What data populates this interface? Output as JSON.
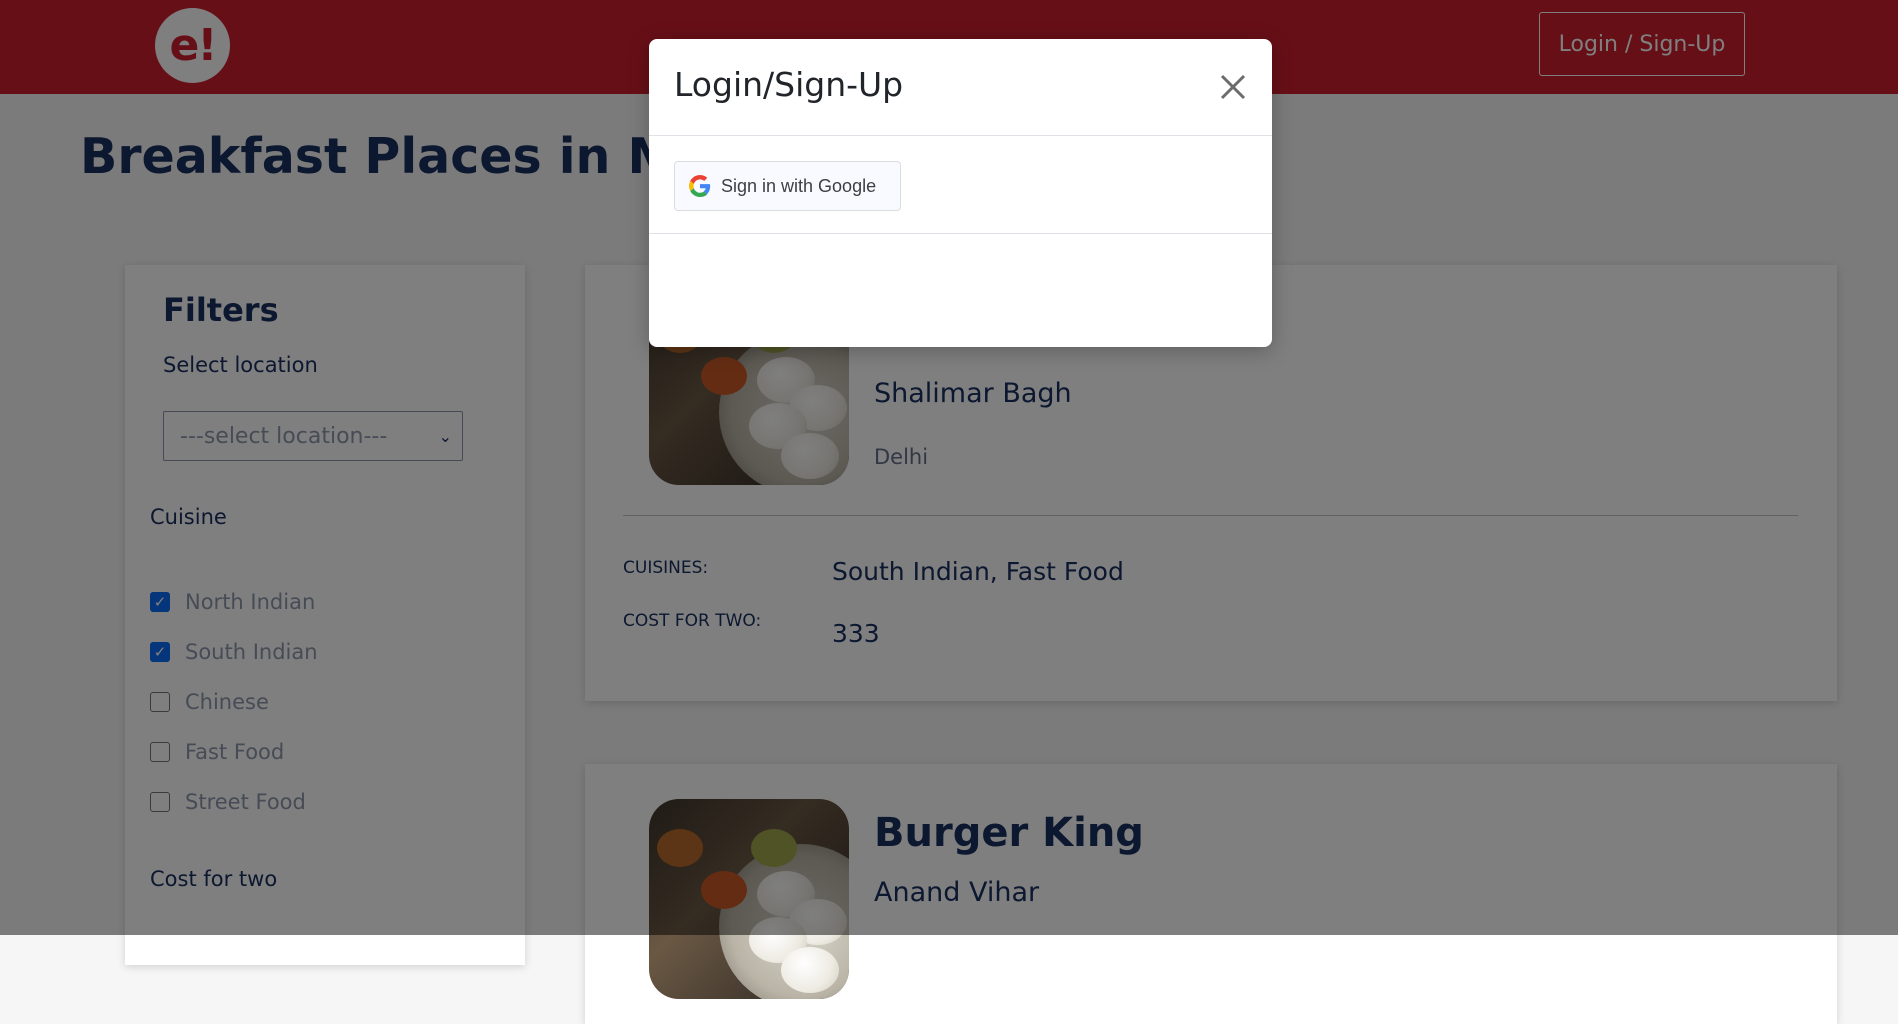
{
  "header": {
    "logo_text": "e!",
    "login_button": "Login / Sign-Up"
  },
  "page": {
    "title": "Breakfast Places in Mumbai"
  },
  "filters": {
    "title": "Filters",
    "location_label": "Select location",
    "location_placeholder": "---select location---",
    "cuisine_label": "Cuisine",
    "cuisines": [
      {
        "label": "North Indian",
        "checked": true
      },
      {
        "label": "South Indian",
        "checked": true
      },
      {
        "label": "Chinese",
        "checked": false
      },
      {
        "label": "Fast Food",
        "checked": false
      },
      {
        "label": "Street Food",
        "checked": false
      }
    ],
    "cost_label": "Cost for two"
  },
  "results": [
    {
      "locality": "Shalimar Bagh",
      "city": "Delhi",
      "cuisines_label": "CUISINES:",
      "cuisines_value": "South Indian, Fast Food",
      "cost_label": "COST FOR TWO:",
      "cost_value": "333"
    },
    {
      "name": "Burger King",
      "locality": "Anand Vihar"
    }
  ],
  "modal": {
    "title": "Login/Sign-Up",
    "google_button": "Sign in with Google"
  },
  "colors": {
    "brand_red": "#ce1f2f",
    "navy_text": "#192f60",
    "checkbox_blue": "#0b6cf6"
  }
}
